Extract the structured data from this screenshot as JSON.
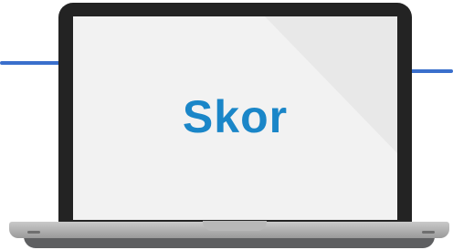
{
  "screen": {
    "word": "Skor"
  },
  "colors": {
    "accent_line": "#3a6fcc",
    "lid_frame": "#232323",
    "screen_bg": "#e8e8e8",
    "screen_glare": "#f2f2f2",
    "word_text": "#1a86c8",
    "base_top": "#c9c9c9",
    "base_bottom": "#9a9a9a",
    "base_shadow": "#5e5f61",
    "notch": "#b8b8b8",
    "foot": "#6f6f6f"
  }
}
